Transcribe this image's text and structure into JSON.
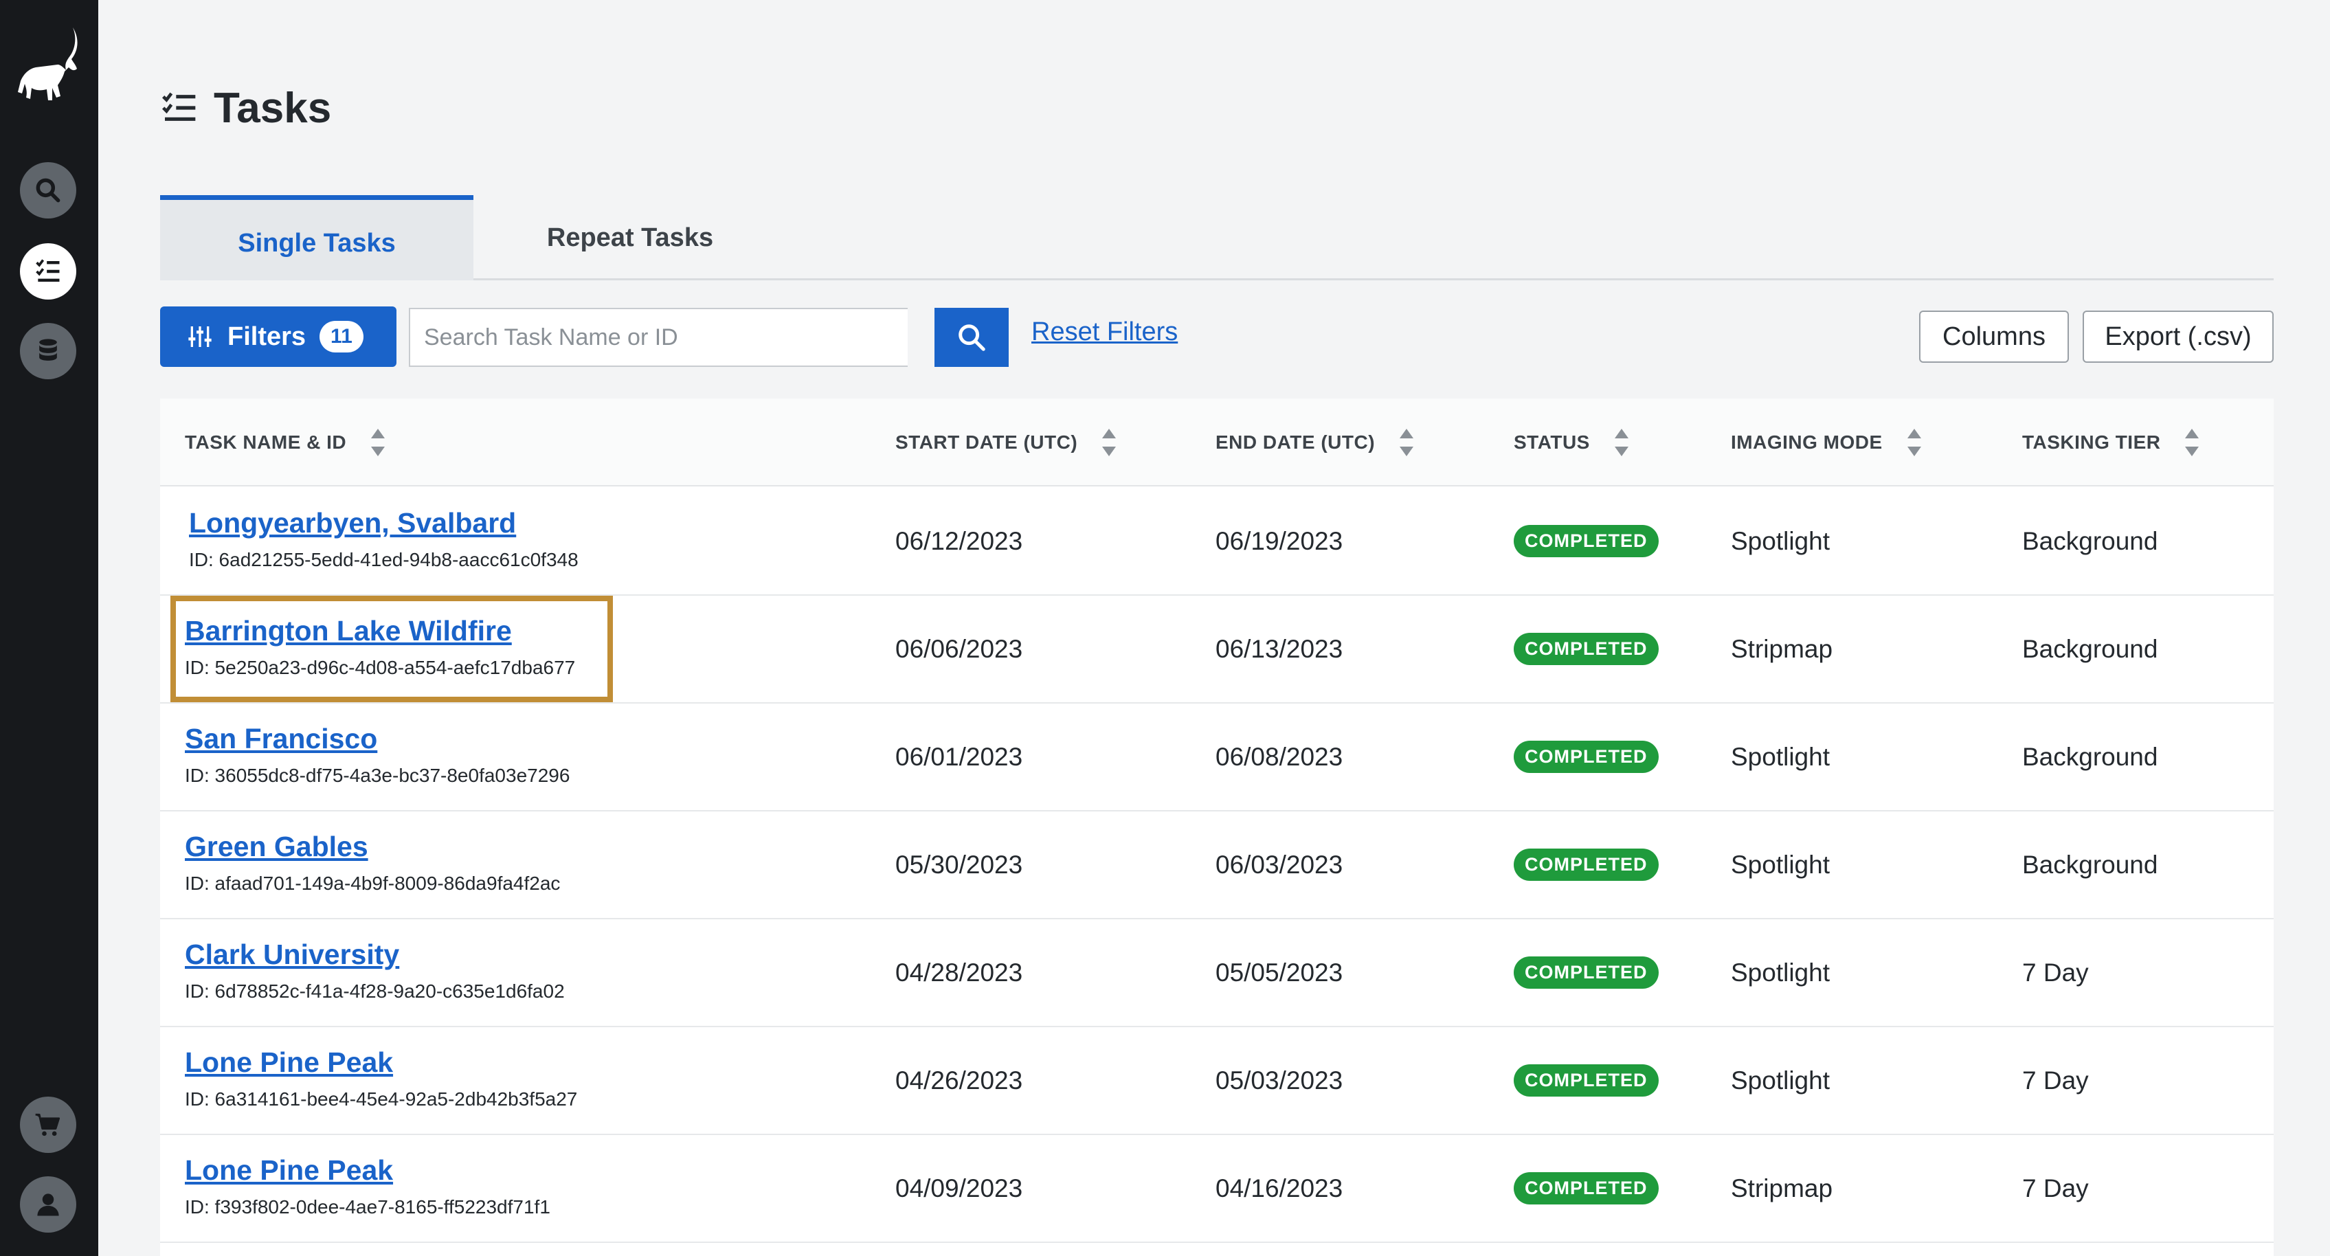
{
  "page": {
    "title": "Tasks"
  },
  "tabs": [
    {
      "label": "Single Tasks",
      "active": true
    },
    {
      "label": "Repeat Tasks",
      "active": false
    }
  ],
  "toolbar": {
    "filters_label": "Filters",
    "filters_count": "11",
    "search_placeholder": "Search Task Name or ID",
    "reset_label": "Reset Filters",
    "columns_label": "Columns",
    "export_label": "Export (.csv)"
  },
  "table": {
    "headers": [
      "TASK NAME & ID",
      "START DATE (UTC)",
      "END DATE (UTC)",
      "STATUS",
      "IMAGING MODE",
      "TASKING TIER"
    ],
    "rows": [
      {
        "name": "Longyearbyen, Svalbard",
        "id": "ID: 6ad21255-5edd-41ed-94b8-aacc61c0f348",
        "start": "06/12/2023",
        "end": "06/19/2023",
        "status": "COMPLETED",
        "mode": "Spotlight",
        "tier": "Background"
      },
      {
        "name": "Barrington Lake Wildfire",
        "id": "ID: 5e250a23-d96c-4d08-a554-aefc17dba677",
        "start": "06/06/2023",
        "end": "06/13/2023",
        "status": "COMPLETED",
        "mode": "Stripmap",
        "tier": "Background"
      },
      {
        "name": "San Francisco",
        "id": "ID: 36055dc8-df75-4a3e-bc37-8e0fa03e7296",
        "start": "06/01/2023",
        "end": "06/08/2023",
        "status": "COMPLETED",
        "mode": "Spotlight",
        "tier": "Background"
      },
      {
        "name": "Green Gables",
        "id": "ID: afaad701-149a-4b9f-8009-86da9fa4f2ac",
        "start": "05/30/2023",
        "end": "06/03/2023",
        "status": "COMPLETED",
        "mode": "Spotlight",
        "tier": "Background"
      },
      {
        "name": "Clark University",
        "id": "ID: 6d78852c-f41a-4f28-9a20-c635e1d6fa02",
        "start": "04/28/2023",
        "end": "05/05/2023",
        "status": "COMPLETED",
        "mode": "Spotlight",
        "tier": "7 Day"
      },
      {
        "name": "Lone Pine Peak",
        "id": "ID: 6a314161-bee4-45e4-92a5-2db42b3f5a27",
        "start": "04/26/2023",
        "end": "05/03/2023",
        "status": "COMPLETED",
        "mode": "Spotlight",
        "tier": "7 Day"
      },
      {
        "name": "Lone Pine Peak",
        "id": "ID: f393f802-0dee-4ae7-8165-ff5223df71f1",
        "start": "04/09/2023",
        "end": "04/16/2023",
        "status": "COMPLETED",
        "mode": "Stripmap",
        "tier": "7 Day"
      }
    ]
  },
  "colors": {
    "accent": "#1a63c9",
    "status_completed": "#1f9b3c",
    "highlight": "#c18e36",
    "sidebar": "#17191c"
  },
  "icons": [
    "logo-ibex-icon",
    "search-icon",
    "tasks-list-icon",
    "database-icon",
    "cart-icon",
    "user-icon",
    "sliders-icon",
    "sort-icon"
  ]
}
